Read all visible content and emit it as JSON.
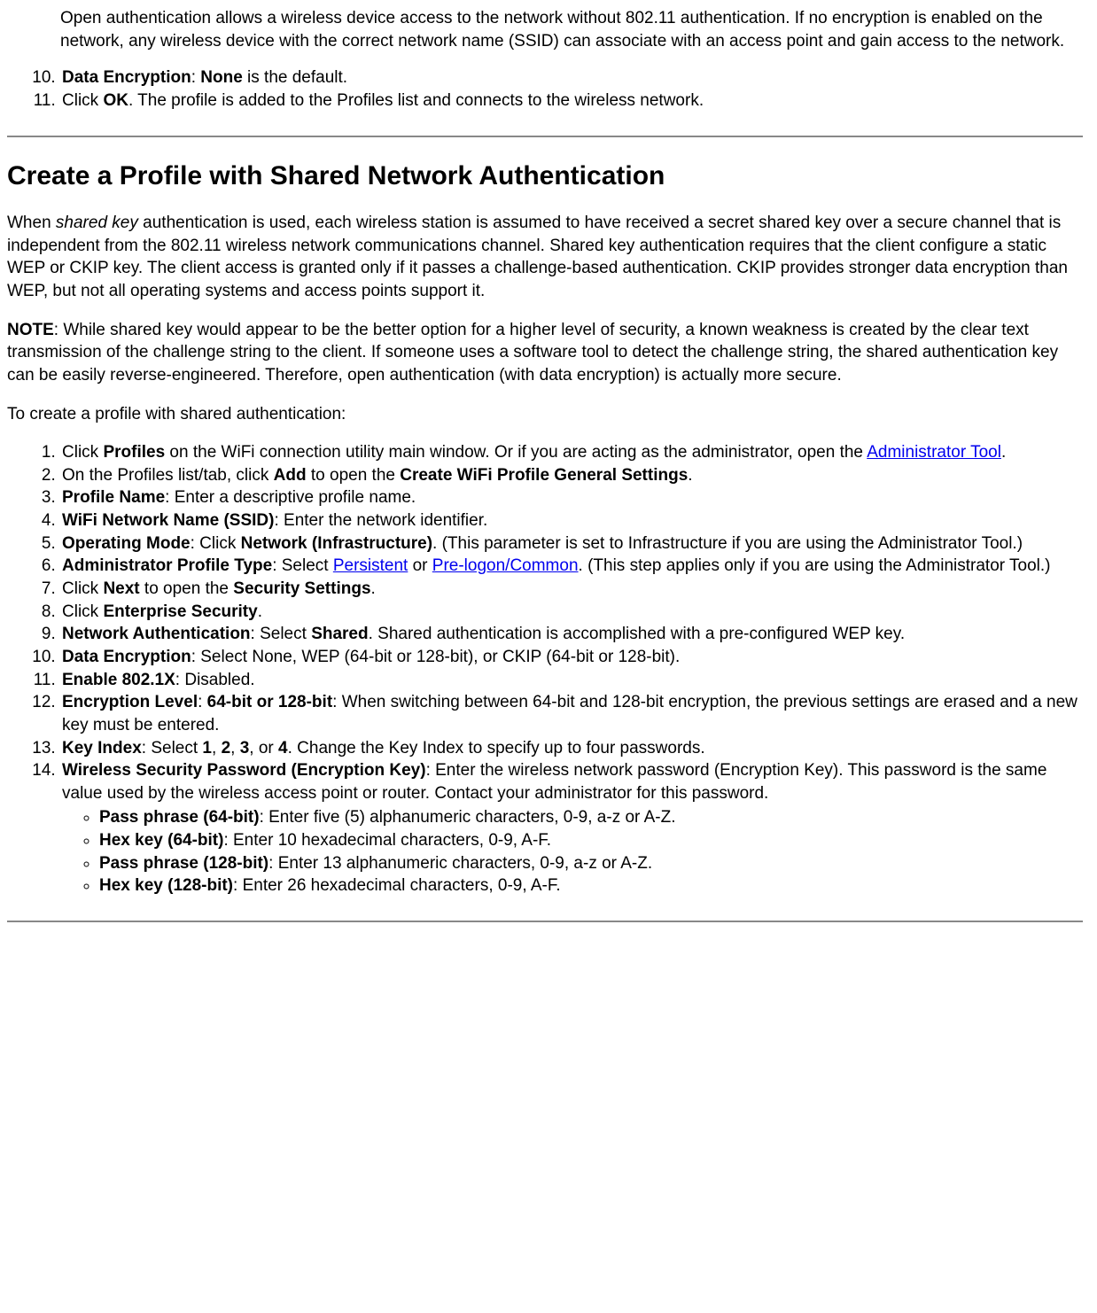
{
  "topParagraph": "Open authentication allows a wireless device access to the network without 802.11 authentication. If no encryption is enabled on the network, any wireless device with the correct network name (SSID) can associate with an access point and gain access to the network.",
  "topList": {
    "start": 10,
    "items": [
      {
        "b1": "Data Encryption",
        "sep": ": ",
        "b2": "None",
        "tail": " is the default."
      },
      {
        "pre": "Click ",
        "b1": "OK",
        "tail": ". The profile is added to the Profiles list and connects to the wireless network."
      }
    ]
  },
  "heading": "Create a Profile with Shared Network Authentication",
  "p1a": "When ",
  "p1i": "shared key",
  "p1b": " authentication is used, each wireless station is assumed to have received a secret shared key over a secure channel that is independent from the 802.11 wireless network communications channel. Shared key authentication requires that the client configure a static WEP or CKIP key. The client access is granted only if it passes a challenge-based authentication. CKIP provides stronger data encryption than WEP, but not all operating systems and access points support it.",
  "noteLabel": "NOTE",
  "noteText": ": While shared key would appear to be the better option for a higher level of security, a known weakness is created by the clear text transmission of the challenge string to the client. If someone uses a software tool to detect the challenge string, the shared authentication key can be easily reverse-engineered. Therefore, open authentication (with data encryption) is actually more secure.",
  "p3": "To create a profile with shared authentication:",
  "steps": {
    "s1a": "Click ",
    "s1b": "Profiles",
    "s1c": " on the WiFi connection utility main window. Or if you are acting as the administrator, open the ",
    "s1link": "Administrator Tool",
    "s1d": ".",
    "s2a": "On the Profiles list/tab, click ",
    "s2b": "Add",
    "s2c": " to open the ",
    "s2d": "Create WiFi Profile General Settings",
    "s2e": ".",
    "s3a": "Profile Name",
    "s3b": ": Enter a descriptive profile name.",
    "s4a": "WiFi Network Name (SSID)",
    "s4b": ": Enter the network identifier.",
    "s5a": "Operating Mode",
    "s5b": ": Click ",
    "s5c": "Network (Infrastructure)",
    "s5d": ". (This parameter is set to Infrastructure if you are using the Administrator Tool.)",
    "s6a": "Administrator Profile Type",
    "s6b": ": Select ",
    "s6c": "Persistent",
    "s6d": " or ",
    "s6e": "Pre-logon/Common",
    "s6f": ". (This step applies only if you are using the Administrator Tool.)",
    "s7a": "Click ",
    "s7b": "Next",
    "s7c": " to open the ",
    "s7d": "Security Settings",
    "s7e": ".",
    "s8a": "Click ",
    "s8b": "Enterprise Security",
    "s8c": ".",
    "s9a": "Network Authentication",
    "s9b": ": Select ",
    "s9c": "Shared",
    "s9d": ". Shared authentication is accomplished with a pre-configured WEP key.",
    "s10a": "Data Encryption",
    "s10b": ": Select None, WEP (64-bit or 128-bit), or CKIP (64-bit or 128-bit).",
    "s11a": "Enable 802.1X",
    "s11b": ": Disabled.",
    "s12a": "Encryption Level",
    "s12b": ": ",
    "s12c": "64-bit or 128-bit",
    "s12d": ": When switching between 64-bit and 128-bit encryption, the previous settings are erased and a new key must be entered.",
    "s13a": "Key Index",
    "s13b": ": Select ",
    "s13c": "1",
    "s13d": ", ",
    "s13e": "2",
    "s13f": ", ",
    "s13g": "3",
    "s13h": ", or ",
    "s13i": "4",
    "s13j": ". Change the Key Index to specify up to four passwords.",
    "s14a": "Wireless Security Password (Encryption Key)",
    "s14b": ": Enter the wireless network password (Encryption Key). This password is the same value used by the wireless access point or router. Contact your administrator for this password.",
    "sub1a": "Pass phrase (64-bit)",
    "sub1b": ": Enter five (5) alphanumeric characters, 0-9, a-z or A-Z.",
    "sub2a": "Hex key (64-bit)",
    "sub2b": ": Enter 10 hexadecimal characters, 0-9, A-F.",
    "sub3a": "Pass phrase (128-bit)",
    "sub3b": ": Enter 13 alphanumeric characters, 0-9, a-z or A-Z.",
    "sub4a": "Hex key (128-bit)",
    "sub4b": ": Enter 26 hexadecimal characters, 0-9, A-F."
  }
}
